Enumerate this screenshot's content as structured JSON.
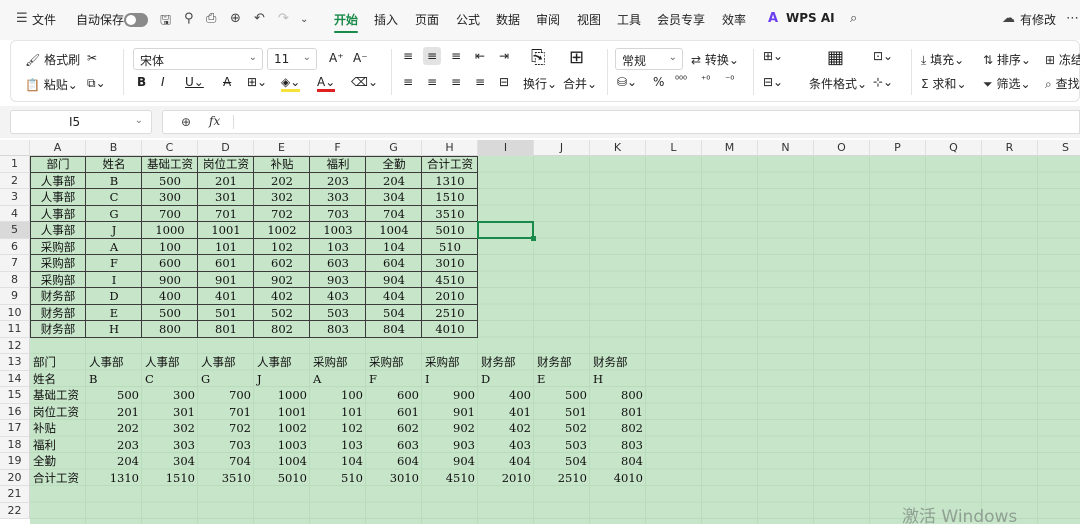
{
  "menubar": {
    "file": "文件",
    "autosave": "自动保存",
    "tabs": [
      "开始",
      "插入",
      "页面",
      "公式",
      "数据",
      "审阅",
      "视图",
      "工具",
      "会员专享",
      "效率"
    ],
    "wps_ai": "WPS AI",
    "modified": "有修改"
  },
  "ribbon": {
    "format_painter": "格式刷",
    "paste": "粘贴",
    "font_name": "宋体",
    "font_size": "11",
    "wrap": "换行",
    "merge": "合并",
    "number_format": "常规",
    "convert": "转换",
    "conditional_format": "条件格式",
    "fill": "填充",
    "sort": "排序",
    "freeze": "冻结",
    "sum": "求和",
    "filter": "筛选",
    "find": "查找"
  },
  "formula_bar": {
    "name_box": "I5",
    "fx": "fx",
    "formula": ""
  },
  "columns": [
    "A",
    "B",
    "C",
    "D",
    "E",
    "F",
    "G",
    "H",
    "I",
    "J",
    "K",
    "L",
    "M",
    "N",
    "O",
    "P",
    "Q",
    "R",
    "S"
  ],
  "selected_column": "I",
  "selected_row": 5,
  "rows": [
    "1",
    "2",
    "3",
    "4",
    "5",
    "6",
    "7",
    "8",
    "9",
    "10",
    "11",
    "12",
    "13",
    "14",
    "15",
    "16",
    "17",
    "18",
    "19",
    "20",
    "21",
    "22"
  ],
  "table1": {
    "headers": [
      "部门",
      "姓名",
      "基础工资",
      "岗位工资",
      "补贴",
      "福利",
      "全勤",
      "合计工资"
    ],
    "rows": [
      [
        "人事部",
        "B",
        "500",
        "201",
        "202",
        "203",
        "204",
        "1310"
      ],
      [
        "人事部",
        "C",
        "300",
        "301",
        "302",
        "303",
        "304",
        "1510"
      ],
      [
        "人事部",
        "G",
        "700",
        "701",
        "702",
        "703",
        "704",
        "3510"
      ],
      [
        "人事部",
        "J",
        "1000",
        "1001",
        "1002",
        "1003",
        "1004",
        "5010"
      ],
      [
        "采购部",
        "A",
        "100",
        "101",
        "102",
        "103",
        "104",
        "510"
      ],
      [
        "采购部",
        "F",
        "600",
        "601",
        "602",
        "603",
        "604",
        "3010"
      ],
      [
        "采购部",
        "I",
        "900",
        "901",
        "902",
        "903",
        "904",
        "4510"
      ],
      [
        "财务部",
        "D",
        "400",
        "401",
        "402",
        "403",
        "404",
        "2010"
      ],
      [
        "财务部",
        "E",
        "500",
        "501",
        "502",
        "503",
        "504",
        "2510"
      ],
      [
        "财务部",
        "H",
        "800",
        "801",
        "802",
        "803",
        "804",
        "4010"
      ]
    ]
  },
  "table2": {
    "rows": [
      [
        "部门",
        "人事部",
        "人事部",
        "人事部",
        "人事部",
        "采购部",
        "采购部",
        "采购部",
        "财务部",
        "财务部",
        "财务部"
      ],
      [
        "姓名",
        "B",
        "C",
        "G",
        "J",
        "A",
        "F",
        "I",
        "D",
        "E",
        "H"
      ],
      [
        "基础工资",
        "500",
        "300",
        "700",
        "1000",
        "100",
        "600",
        "900",
        "400",
        "500",
        "800"
      ],
      [
        "岗位工资",
        "201",
        "301",
        "701",
        "1001",
        "101",
        "601",
        "901",
        "401",
        "501",
        "801"
      ],
      [
        "补贴",
        "202",
        "302",
        "702",
        "1002",
        "102",
        "602",
        "902",
        "402",
        "502",
        "802"
      ],
      [
        "福利",
        "203",
        "303",
        "703",
        "1003",
        "103",
        "603",
        "903",
        "403",
        "503",
        "803"
      ],
      [
        "全勤",
        "204",
        "304",
        "704",
        "1004",
        "104",
        "604",
        "904",
        "404",
        "504",
        "804"
      ],
      [
        "合计工资",
        "1310",
        "1510",
        "3510",
        "5010",
        "510",
        "3010",
        "4510",
        "2010",
        "2510",
        "4010"
      ]
    ]
  },
  "watermark": "激活 Windows"
}
